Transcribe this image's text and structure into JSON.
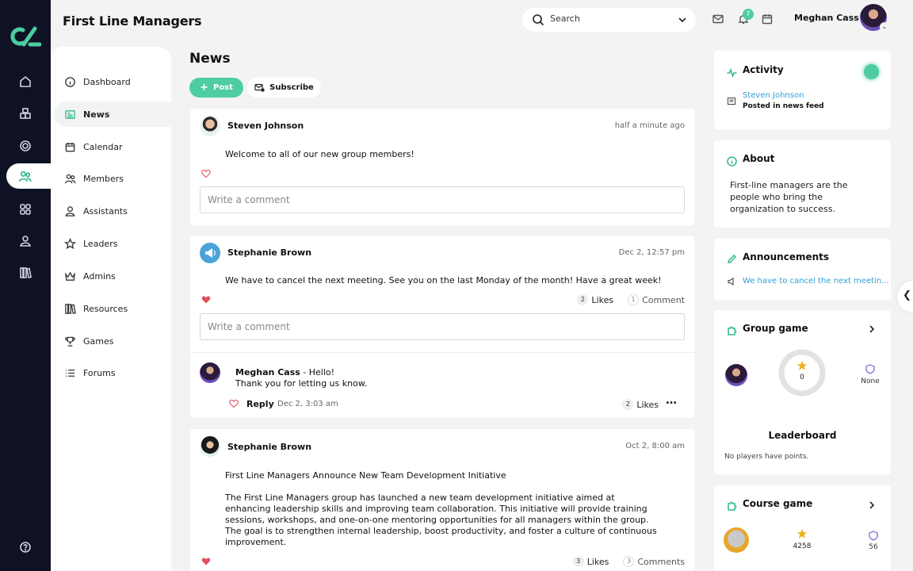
{
  "header": {
    "title": "First Line Managers",
    "search_label": "Search",
    "notification_count": "7",
    "user_name": "Meghan Cass"
  },
  "rail": {
    "icons": [
      "home-icon",
      "cube-icon",
      "target-icon",
      "people-icon",
      "apps-icon",
      "user-icon",
      "library-icon",
      "help-icon"
    ],
    "active": "people-icon"
  },
  "sidebar": {
    "items": [
      {
        "label": "Dashboard",
        "icon": "info-icon"
      },
      {
        "label": "News",
        "icon": "newspaper-icon",
        "active": true
      },
      {
        "label": "Calendar",
        "icon": "calendar-icon"
      },
      {
        "label": "Members",
        "icon": "members-icon"
      },
      {
        "label": "Assistants",
        "icon": "assistant-icon"
      },
      {
        "label": "Leaders",
        "icon": "star-icon"
      },
      {
        "label": "Admins",
        "icon": "crown-icon"
      },
      {
        "label": "Resources",
        "icon": "books-icon"
      },
      {
        "label": "Games",
        "icon": "trophy-icon"
      },
      {
        "label": "Forums",
        "icon": "list-icon"
      }
    ]
  },
  "main": {
    "title": "News",
    "post_button": "Post",
    "subscribe_button": "Subscribe",
    "comment_placeholder": "Write a comment",
    "posts": [
      {
        "author": "Steven Johnson",
        "time": "half a minute ago",
        "body": "Welcome to all of our new group members!"
      },
      {
        "author": "Stephanie Brown",
        "time": "Dec 2, 12:57 pm",
        "body": "We have to cancel the next meeting. See you on the last Monday of the month! Have a great week!",
        "likes_count": "2",
        "likes_label": "Likes",
        "comments_count": "1",
        "comments_label": "Comment",
        "reply": {
          "author": "Meghan Cass",
          "separator": " - ",
          "line1": "Hello!",
          "line2": "Thank you for letting us know.",
          "reply_label": "Reply",
          "time": "Dec 2, 3:03 am",
          "likes_count": "2",
          "likes_label": "Likes",
          "more": "…"
        }
      },
      {
        "author": "Stephanie Brown",
        "time": "Oct 2, 8:00 am",
        "headline": "First Line Managers Announce New Team Development Initiative",
        "body_lines": [
          "The First Line Managers group has launched a new team development initiative aimed at",
          "enhancing leadership skills and improving team collaboration. This initiative will provide training",
          "sessions, workshops, and one-on-one mentoring opportunities for all managers within the group.",
          "The goal is to strengthen internal leadership, boost productivity, and foster a culture of continuous",
          "improvement."
        ],
        "likes_count": "3",
        "likes_label": "Likes",
        "comments_count": "3",
        "comments_label": "Comments"
      }
    ]
  },
  "right": {
    "activity": {
      "title": "Activity",
      "user": "Steven Johnson",
      "action": "Posted in news feed"
    },
    "about": {
      "title": "About",
      "lines": [
        "First-line managers are the",
        "people who bring the",
        "organization to success."
      ]
    },
    "announcements": {
      "title": "Announcements",
      "item": "We have to cancel the next meetin..."
    },
    "group_game": {
      "title": "Group game",
      "score": "0",
      "badge_label": "None",
      "progress": 0,
      "leaderboard_title": "Leaderboard",
      "leaderboard_empty": "No players have points."
    },
    "course_game": {
      "title": "Course game",
      "points": "4258",
      "badge_value": "56"
    }
  },
  "colors": {
    "accent": "#4dcda0",
    "rail_bg": "#0f1225",
    "link": "#2e9fd6",
    "heart": "#e45060"
  }
}
